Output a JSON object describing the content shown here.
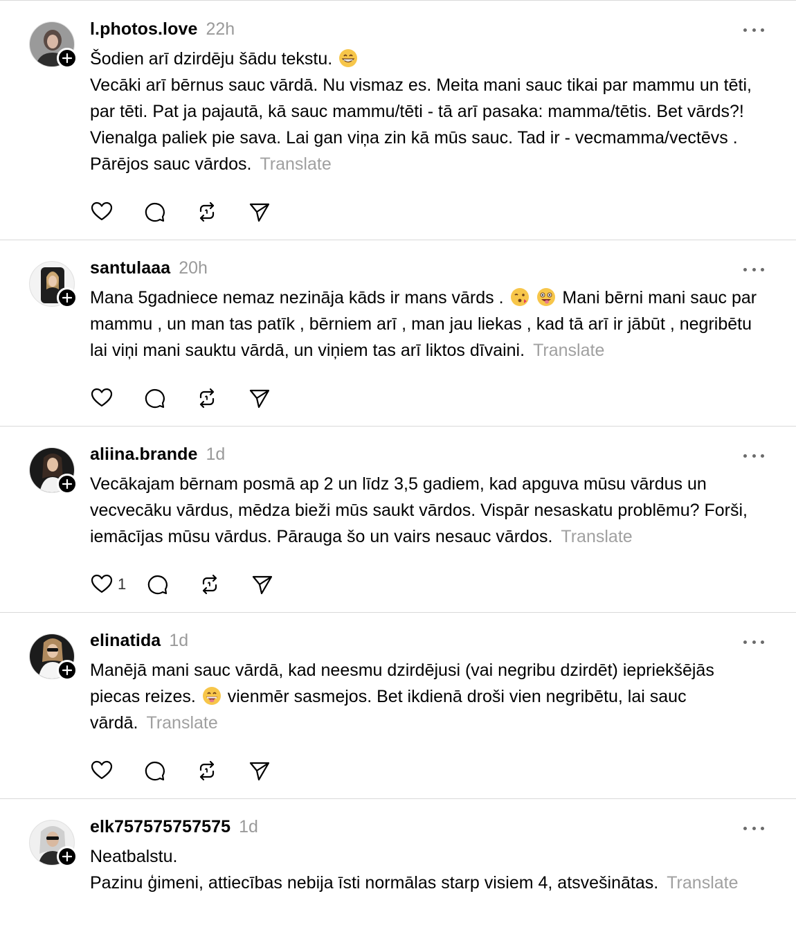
{
  "ui": {
    "translate_label": "Translate",
    "icons": [
      "heart-icon",
      "comment-icon",
      "repost-icon",
      "share-icon",
      "more-icon",
      "plus-icon"
    ]
  },
  "posts": [
    {
      "username": "l.photos.love",
      "time": "22h",
      "lines": [
        "Šodien arī dzirdēju šādu tekstu. ",
        "Vecāki arī bērnus sauc vārdā. Nu vismaz es. Meita mani sauc tikai par mammu un tēti, par tēti. Pat ja pajautā, kā sauc mammu/tēti - tā arī pasaka: mamma/tētis. Bet vārds?! Vienalga paliek pie sava. Lai gan viņa zin kā mūs sauc. Tad ir - vecmamma/vectēvs . Pārējos sauc vārdos."
      ],
      "likes": ""
    },
    {
      "username": "santulaaa",
      "time": "20h",
      "text_a": "Mana 5gadniece nemaz nezināja kāds ir mans vārds . ",
      "text_b": " Mani bērni mani sauc par mammu , un man tas patīk , bērniem arī , man jau liekas , kad tā arī ir jābūt , negribētu lai viņi mani sauktu vārdā, un viņiem tas arī liktos dīvaini.",
      "likes": ""
    },
    {
      "username": "aliina.brande",
      "time": "1d",
      "text": "Vecākajam bērnam posmā ap 2 un līdz 3,5 gadiem, kad apguva mūsu vārdus un vecvecāku vārdus, mēdza bieži mūs saukt vārdos. Vispār nesaskatu problēmu? Forši, iemācījas mūsu vārdus. Pārauga šo un vairs nesauc vārdos.",
      "likes": "1"
    },
    {
      "username": "elinatida",
      "time": "1d",
      "text_a": "Manējā mani sauc vārdā, kad neesmu dzirdējusi (vai negribu dzirdēt) iepriekšējās piecas reizes. ",
      "text_b": " vienmēr sasmejos. Bet ikdienā droši vien negribētu, lai sauc vārdā.",
      "likes": ""
    },
    {
      "username": "elk757575757575",
      "time": "1d",
      "lines": [
        "Neatbalstu.",
        "Pazinu ģimeni, attiecības nebija īsti normālas starp visiem 4, atsvešinātas."
      ],
      "likes": ""
    }
  ]
}
